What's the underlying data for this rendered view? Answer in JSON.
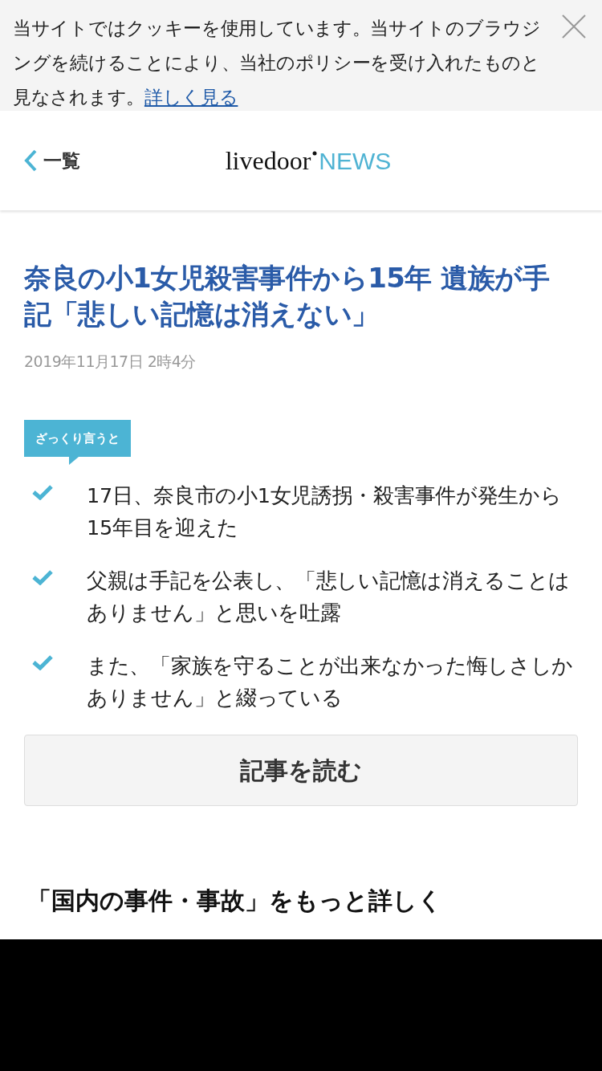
{
  "cookie_banner": {
    "text": "当サイトではクッキーを使用しています。当サイトのブラウジングを続けることにより、当社のポリシーを受け入れたものと見なされます。",
    "link": "詳しく見る"
  },
  "header": {
    "back_label": "一覧",
    "logo_main": "livedoor",
    "logo_sub": "NEWS"
  },
  "article": {
    "title": "奈良の小1女児殺害事件から15年 遺族が手記「悲しい記憶は消えない」",
    "date": "2019年11月17日 2時4分",
    "summary_label": "ざっくり言うと",
    "summary": [
      {
        "text": "17日、奈良市の小1女児誘拐・殺害事件が発生から15年目を迎えた"
      },
      {
        "text": "父親は手記を公表し、「悲しい記憶は消えることはありません」と思いを吐露"
      },
      {
        "text": "また、「家族を守ることが出来なかった悔しさしかありません」と綴っている"
      }
    ],
    "read_button": "記事を読む"
  },
  "more_heading": "「国内の事件・事故」をもっと詳しく"
}
